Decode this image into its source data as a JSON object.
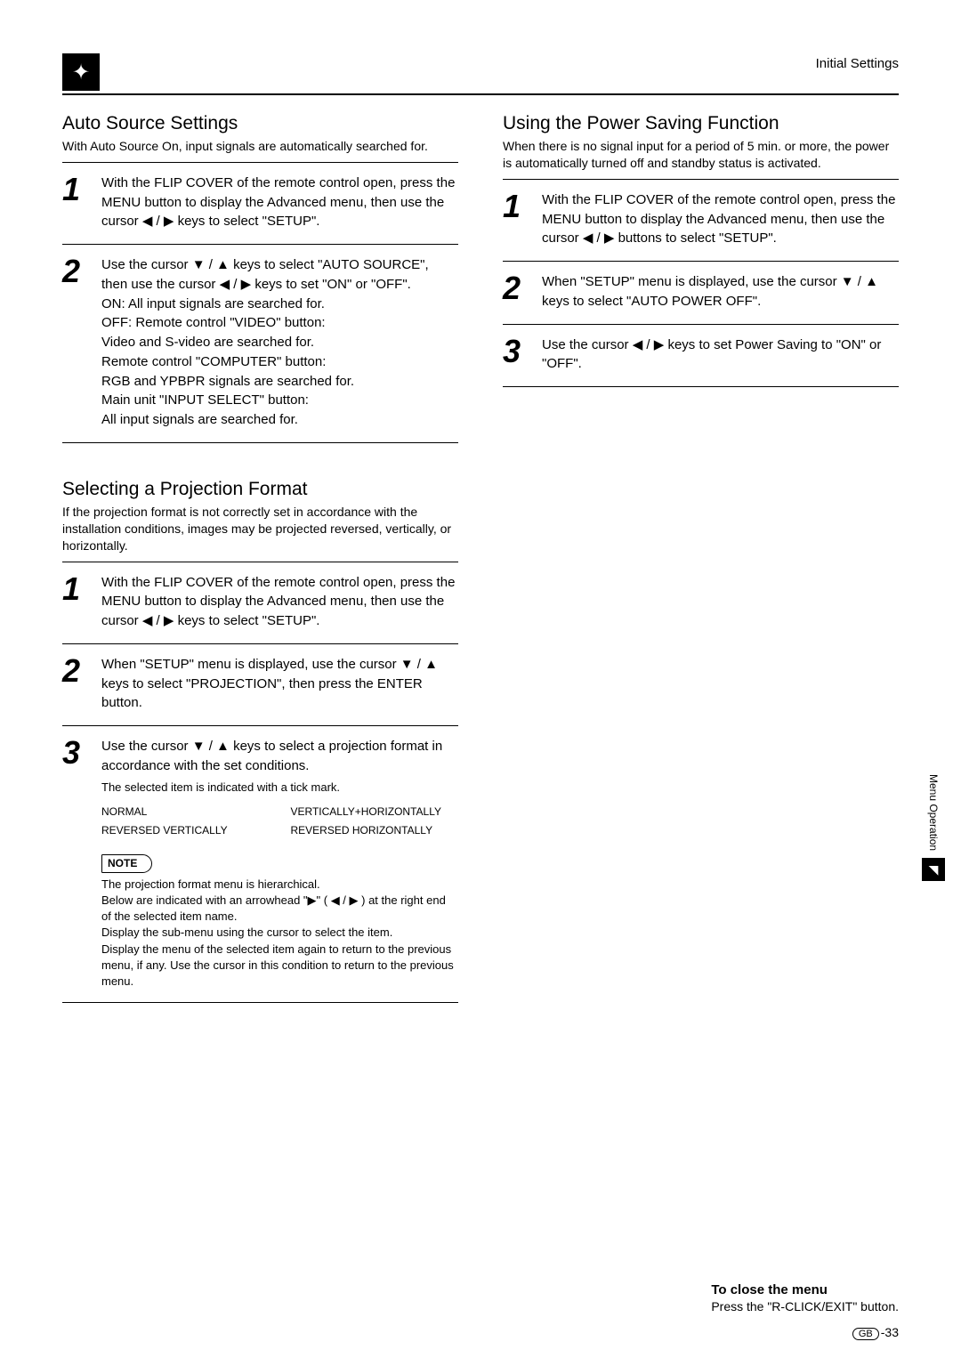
{
  "header": {
    "breadcrumb": "Initial Settings"
  },
  "left": {
    "sec1": {
      "title": "Auto Source Settings",
      "intro": "With Auto Source On, input signals are automatically searched for.",
      "step1": "With the FLIP COVER of the remote control open, press the MENU button to display the Advanced menu, then use the cursor ◀ / ▶ keys to select \"SETUP\".",
      "step2a": "Use the cursor  ▼ / ▲ keys to select \"AUTO SOURCE\", then use the cursor ◀ / ▶ keys to set \"ON\" or \"OFF\".",
      "step2b_on": "ON:    All input signals are searched for.",
      "step2b_off": "OFF:  Remote control \"VIDEO\" button:",
      "step2b_off2": "           Video and S-video are searched for.",
      "step2b_off3": "           Remote control \"COMPUTER\" button:",
      "step2b_off4": "           RGB and YPBPR signals are searched for.",
      "step2b_off5": "           Main unit \"INPUT SELECT\" button:",
      "step2b_off6": "           All input signals are searched for."
    },
    "sec2": {
      "title": "Selecting a Projection Format",
      "intro": "If the projection format is not correctly set in accordance with the installation conditions, images may be projected reversed, vertically, or horizontally.",
      "step1": "With the FLIP COVER of the remote control open, press the MENU button to display the Advanced menu, then use the cursor ◀ / ▶ keys to select \"SETUP\".",
      "step2": "When \"SETUP\" menu is displayed, use the cursor ▼ / ▲ keys to select \"PROJECTION\", then press the ENTER button.",
      "step3a": "Use the cursor  ▼ / ▲ keys to select a projection format in accordance with the set conditions.",
      "step3b": "The selected item is indicated with a tick mark.",
      "fmt1": "NORMAL",
      "fmt2": "VERTICALLY+HORIZONTALLY",
      "fmt3": "REVERSED VERTICALLY",
      "fmt4": "REVERSED HORIZONTALLY",
      "note_label": "NOTE",
      "note1": "The projection format menu is hierarchical.",
      "note2": "Below are indicated with an arrowhead \"▶\" ( ◀ / ▶ ) at the right end of the selected item name.",
      "note3": "Display the sub-menu using the cursor to select the item.",
      "note4": "Display the menu of the selected item again to return to the previous menu, if any. Use the cursor in this condition to return to the previous menu."
    }
  },
  "right": {
    "sec1": {
      "title": "Using the Power Saving Function",
      "intro": "When there is no signal input for a period of 5 min. or more, the power is automatically turned off and standby status is activated.",
      "step1": "With the FLIP COVER of the remote control open, press the MENU button to display the Advanced menu, then use the cursor ◀ / ▶ buttons to select \"SETUP\".",
      "step2": "When \"SETUP\" menu is displayed, use the cursor ▼ / ▲ keys to select \"AUTO POWER OFF\".",
      "step3": "Use the cursor ◀ / ▶ keys to set Power Saving to \"ON\" or \"OFF\"."
    }
  },
  "sideTab": "Menu Operation",
  "footer": {
    "title": "To close the menu",
    "body": "Press the \"R-CLICK/EXIT\" button."
  },
  "pageLabel": "GB",
  "pageNum": "-33"
}
